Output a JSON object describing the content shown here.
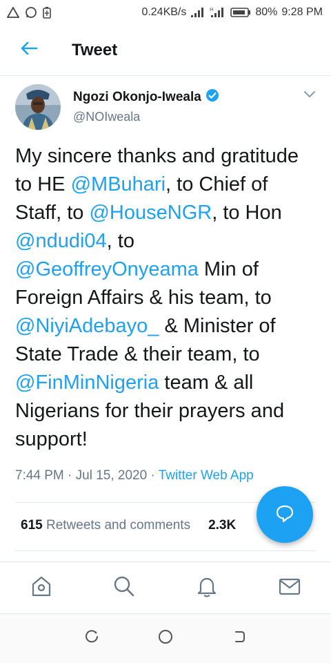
{
  "status_bar": {
    "speed": "0.24KB/s",
    "battery": "80%",
    "time": "9:28 PM"
  },
  "header": {
    "title": "Tweet"
  },
  "tweet": {
    "author_name": "Ngozi Okonjo-Iweala",
    "author_handle": "@NOIweala",
    "segments": [
      {
        "text": "My sincere thanks and gratitude to HE ",
        "mention": false
      },
      {
        "text": "@MBuhari",
        "mention": true
      },
      {
        "text": ", to Chief of Staff, to ",
        "mention": false
      },
      {
        "text": "@HouseNGR",
        "mention": true
      },
      {
        "text": ", to Hon ",
        "mention": false
      },
      {
        "text": "@ndudi04",
        "mention": true
      },
      {
        "text": ", to ",
        "mention": false
      },
      {
        "text": "@GeoffreyOnyeama",
        "mention": true
      },
      {
        "text": " Min of Foreign Affairs & his team, to ",
        "mention": false
      },
      {
        "text": "@NiyiAdebayo_",
        "mention": true
      },
      {
        "text": " & Minister of State Trade & their team, to ",
        "mention": false
      },
      {
        "text": "@FinMinNigeria",
        "mention": true
      },
      {
        "text": " team & all Nigerians for their prayers and support!",
        "mention": false
      }
    ],
    "time": "7:44 PM",
    "date": "Jul 15, 2020",
    "separator": "·",
    "source": "Twitter Web App"
  },
  "stats": {
    "retweets_count": "615",
    "retweets_label": "Retweets and comments",
    "likes_count": "2.3K"
  },
  "nav": {
    "items": [
      "home-icon",
      "search-icon",
      "notifications-icon",
      "messages-icon"
    ]
  },
  "colors": {
    "accent": "#1da1f2",
    "text": "#14171a",
    "muted": "#657786",
    "divider": "#e1e8ed"
  }
}
